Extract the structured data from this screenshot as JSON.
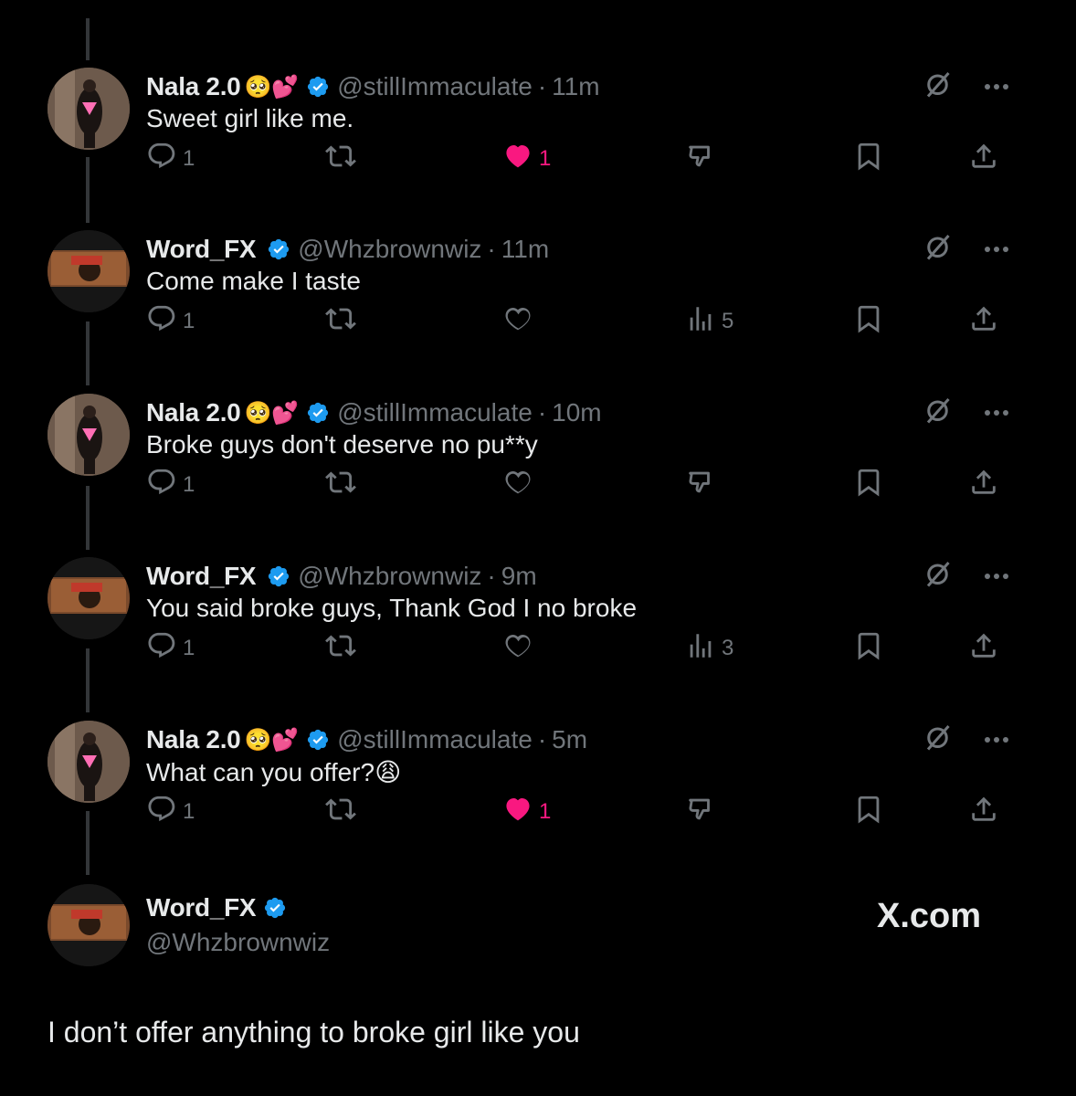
{
  "colors": {
    "background": "#000000",
    "text": "#e7e9ea",
    "muted": "#71767b",
    "verified": "#1d9bf0",
    "like": "#f91880"
  },
  "tweets": [
    {
      "name": "Nala 2.0",
      "emojis": "🥺💕",
      "handle": "@stillImmaculate",
      "dot": "·",
      "time": "11m",
      "text": "Sweet girl like me.",
      "reply_count": "1",
      "like_count": "1",
      "liked": true,
      "extra": "dislike",
      "extra_count": ""
    },
    {
      "name": "Word_FX",
      "emojis": "",
      "handle": "@Whzbrownwiz",
      "dot": "·",
      "time": "11m",
      "text": "Come make I taste",
      "reply_count": "1",
      "like_count": "",
      "liked": false,
      "extra": "views",
      "extra_count": "5"
    },
    {
      "name": "Nala 2.0",
      "emojis": "🥺💕",
      "handle": "@stillImmaculate",
      "dot": "·",
      "time": "10m",
      "text": "Broke guys don't deserve no pu**y",
      "reply_count": "1",
      "like_count": "",
      "liked": false,
      "extra": "dislike",
      "extra_count": ""
    },
    {
      "name": "Word_FX",
      "emojis": "",
      "handle": "@Whzbrownwiz",
      "dot": "·",
      "time": "9m",
      "text": "You said broke guys, Thank God I no broke",
      "reply_count": "1",
      "like_count": "",
      "liked": false,
      "extra": "views",
      "extra_count": "3"
    },
    {
      "name": "Nala 2.0",
      "emojis": "🥺💕",
      "handle": "@stillImmaculate",
      "dot": "·",
      "time": "5m",
      "text": "What can you offer?😩",
      "reply_count": "1",
      "like_count": "1",
      "liked": true,
      "extra": "dislike",
      "extra_count": ""
    }
  ],
  "main_post": {
    "name": "Word_FX",
    "handle": "@Whzbrownwiz",
    "site": "X.com",
    "text": "I don’t offer anything to broke girl like you"
  },
  "icons": {
    "grok": "grok-icon",
    "more": "more-icon",
    "reply": "reply-icon",
    "retweet": "retweet-icon",
    "like": "heart-icon",
    "dislike": "dislike-icon",
    "views": "views-icon",
    "bookmark": "bookmark-icon",
    "share": "share-icon",
    "verified": "verified-badge-icon"
  }
}
